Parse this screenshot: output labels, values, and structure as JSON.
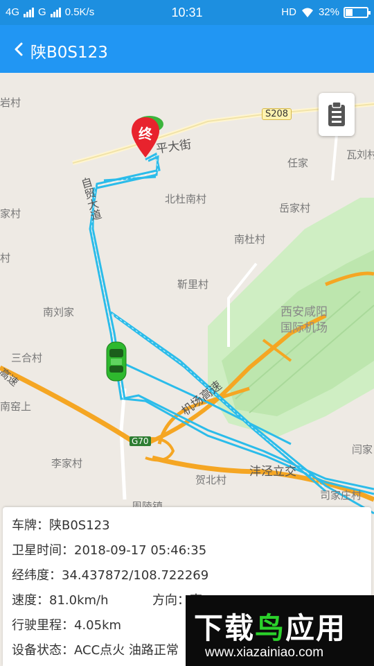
{
  "status_bar": {
    "sim1": "4G",
    "sim2": "G",
    "speed": "0.5K/s",
    "time": "10:31",
    "hd": "HD",
    "battery": "32%",
    "battery_level": 32
  },
  "nav": {
    "back_icon": "chevron-left-icon",
    "title": "陕B0S123"
  },
  "map": {
    "labels": {
      "yancun": "岩村",
      "s208": "S208",
      "pingdajie": "平大街",
      "waliucun": "瓦刘村",
      "renjia": "任家",
      "zimaodadao": "自贸大道",
      "beidunancun": "北杜南村",
      "yuejiacun": "岳家村",
      "jiacun": "家村",
      "nandu": "南杜村",
      "cun": "村",
      "jinlicun": "靳里村",
      "airport_line1": "西安咸阳",
      "airport_line2": "国际机场",
      "nanliujia": "南刘家",
      "sanhecun": "三合村",
      "gaosu": "高速",
      "jichanggaosu": "机场高速",
      "nanyaoshang": "南窑上",
      "g70": "G70",
      "lijiacun": "李家村",
      "fengjingliji": "沣泾立交",
      "hebeicun": "贺北村",
      "yanjia": "闫家",
      "sijiazhuangcun": "司家庄村",
      "chenzhen": "周陵镇"
    },
    "end_marker": "终",
    "clipboard_icon": "clipboard-icon",
    "car_icon": "car-icon",
    "colors": {
      "track": "#2bbcea",
      "highway": "#f5a623",
      "airport": "#bfe8b0",
      "marker": "#e8232d",
      "car": "#2eb82e"
    }
  },
  "info": {
    "plate": "车牌：陕B0S123",
    "gps_time": "卫星时间：2018-09-17 05:46:35",
    "latlng": "经纬度：34.437872/108.722269",
    "speed": "速度：81.0km/h",
    "direction": "方向：南",
    "mileage": "行驶里程：4.05km",
    "device_status": "设备状态：ACC点火 油路正常"
  },
  "watermark": {
    "text_white": "下载",
    "text_green": "鸟",
    "text_white2": "应用",
    "url": "www.xiazainiao.com"
  }
}
